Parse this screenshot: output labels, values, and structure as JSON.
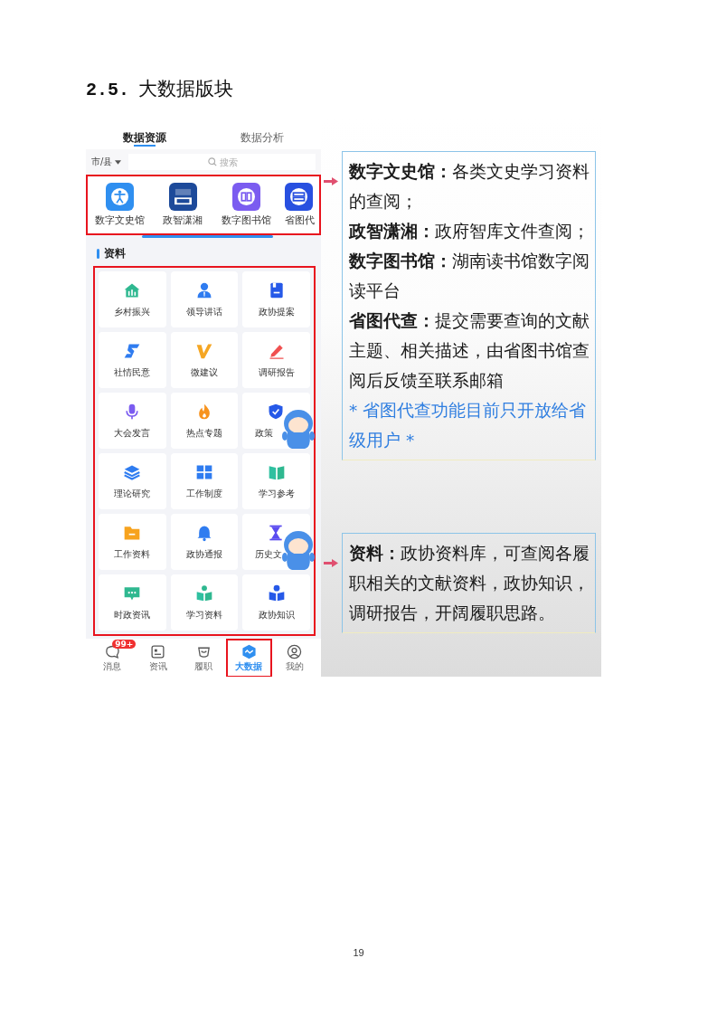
{
  "heading": {
    "number": "2.5.",
    "title": "大数据版块"
  },
  "phone": {
    "tabs": [
      {
        "label": "数据资源",
        "selected": true
      },
      {
        "label": "数据分析",
        "selected": false
      }
    ],
    "region_filter": "市/县",
    "search": {
      "placeholder": "搜索"
    },
    "apps": {
      "highlighted": true,
      "items": [
        {
          "label": "数字文史馆"
        },
        {
          "label": "政智潇湘"
        },
        {
          "label": "数字图书馆"
        },
        {
          "label": "省图代"
        }
      ]
    },
    "section_title": "资料",
    "materials": {
      "highlighted": true,
      "items": [
        {
          "label": "乡村振兴",
          "mascot": false
        },
        {
          "label": "领导讲话",
          "mascot": false
        },
        {
          "label": "政协提案",
          "mascot": false
        },
        {
          "label": "社情民意",
          "mascot": false
        },
        {
          "label": "微建议",
          "mascot": false
        },
        {
          "label": "调研报告",
          "mascot": false
        },
        {
          "label": "大会发言",
          "mascot": false
        },
        {
          "label": "热点专题",
          "mascot": false
        },
        {
          "label": "政策",
          "mascot": true
        },
        {
          "label": "理论研究",
          "mascot": false
        },
        {
          "label": "工作制度",
          "mascot": false
        },
        {
          "label": "学习参考",
          "mascot": false
        },
        {
          "label": "工作资料",
          "mascot": false
        },
        {
          "label": "政协通报",
          "mascot": false
        },
        {
          "label": "历史文",
          "mascot": true
        },
        {
          "label": "时政资讯",
          "mascot": false
        },
        {
          "label": "学习资料",
          "mascot": false
        },
        {
          "label": "政协知识",
          "mascot": false
        }
      ]
    },
    "nav": [
      {
        "label": "消息",
        "selected": false,
        "highlighted": false,
        "badge": "99+"
      },
      {
        "label": "资讯",
        "selected": false,
        "highlighted": false
      },
      {
        "label": "履职",
        "selected": false,
        "highlighted": false
      },
      {
        "label": "大数据",
        "selected": true,
        "highlighted": true
      },
      {
        "label": "我的",
        "selected": false,
        "highlighted": false
      }
    ]
  },
  "notes": [
    {
      "paragraphs": [
        {
          "kind": "normal",
          "text": "**数字文史馆：**各类文史学习资料的查阅；"
        },
        {
          "kind": "normal",
          "text": "**政智潇湘：**政府智库文件查阅；"
        },
        {
          "kind": "normal",
          "text": "**数字图书馆：**湖南读书馆数字阅读平台"
        },
        {
          "kind": "normal",
          "text": "**省图代查：**提交需要查询的文献主题、相关描述，由省图书馆查阅后反馈至联系邮箱"
        },
        {
          "kind": "notice",
          "text": "* 省图代查功能目前只开放给省级用户 *"
        }
      ]
    },
    {
      "paragraphs": [
        {
          "kind": "normal",
          "text": "**资料：**政协资料库，可查阅各履职相关的文献资料，政协知识，调研报告，开阔履职思路。"
        }
      ]
    }
  ],
  "page_number": "19"
}
